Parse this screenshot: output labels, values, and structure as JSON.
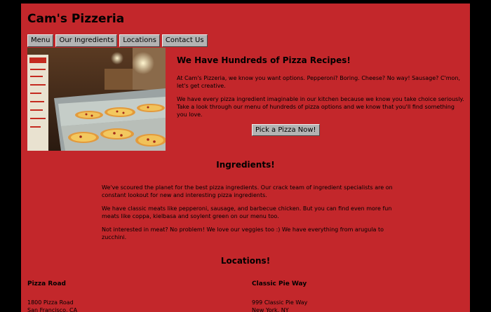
{
  "site": {
    "title": "Cam's Pizzeria"
  },
  "nav": {
    "items": [
      "Menu",
      "Our Ingredients",
      "Locations",
      "Contact Us"
    ]
  },
  "intro": {
    "heading": "We Have Hundreds of Pizza Recipes!",
    "paragraph1": "At Cam's Pizzeria, we know you want options. Pepperoni? Boring. Cheese? No way! Sausage? C'mon, let's get creative.",
    "paragraph2": "We have every pizza ingredient imaginable in our kitchen because we know you take choice seriously. Take a look through our menu of hundreds of pizza options and we know that you'll find something you love.",
    "cta_label": "Pick a Pizza Now!"
  },
  "ingredients": {
    "heading": "Ingredients!",
    "paragraphs": [
      "We've scoured the planet for the best pizza ingredients. Our crack team of ingredient specialists are on constant lookout for new and interesting pizza ingredients.",
      "We have classic meats like pepperoni, sausage, and barbecue chicken. But you can find even more fun meats like coppa, kielbasa and soylent green on our menu too.",
      "Not interested in meat? No problem! We love our veggies too :) We have everything from arugula to zucchini."
    ]
  },
  "locations": {
    "heading": "Locations!",
    "items": [
      {
        "name": "Pizza Road",
        "address": "1800 Pizza Road",
        "city": "San Francisco, CA"
      },
      {
        "name": "Classic Pie Way",
        "address": "999 Classic Pie Way",
        "city": "New York, NY"
      }
    ]
  },
  "colors": {
    "page_background": "#c3272b",
    "outer_background": "#000000",
    "button_face": "#b3b3b3"
  }
}
